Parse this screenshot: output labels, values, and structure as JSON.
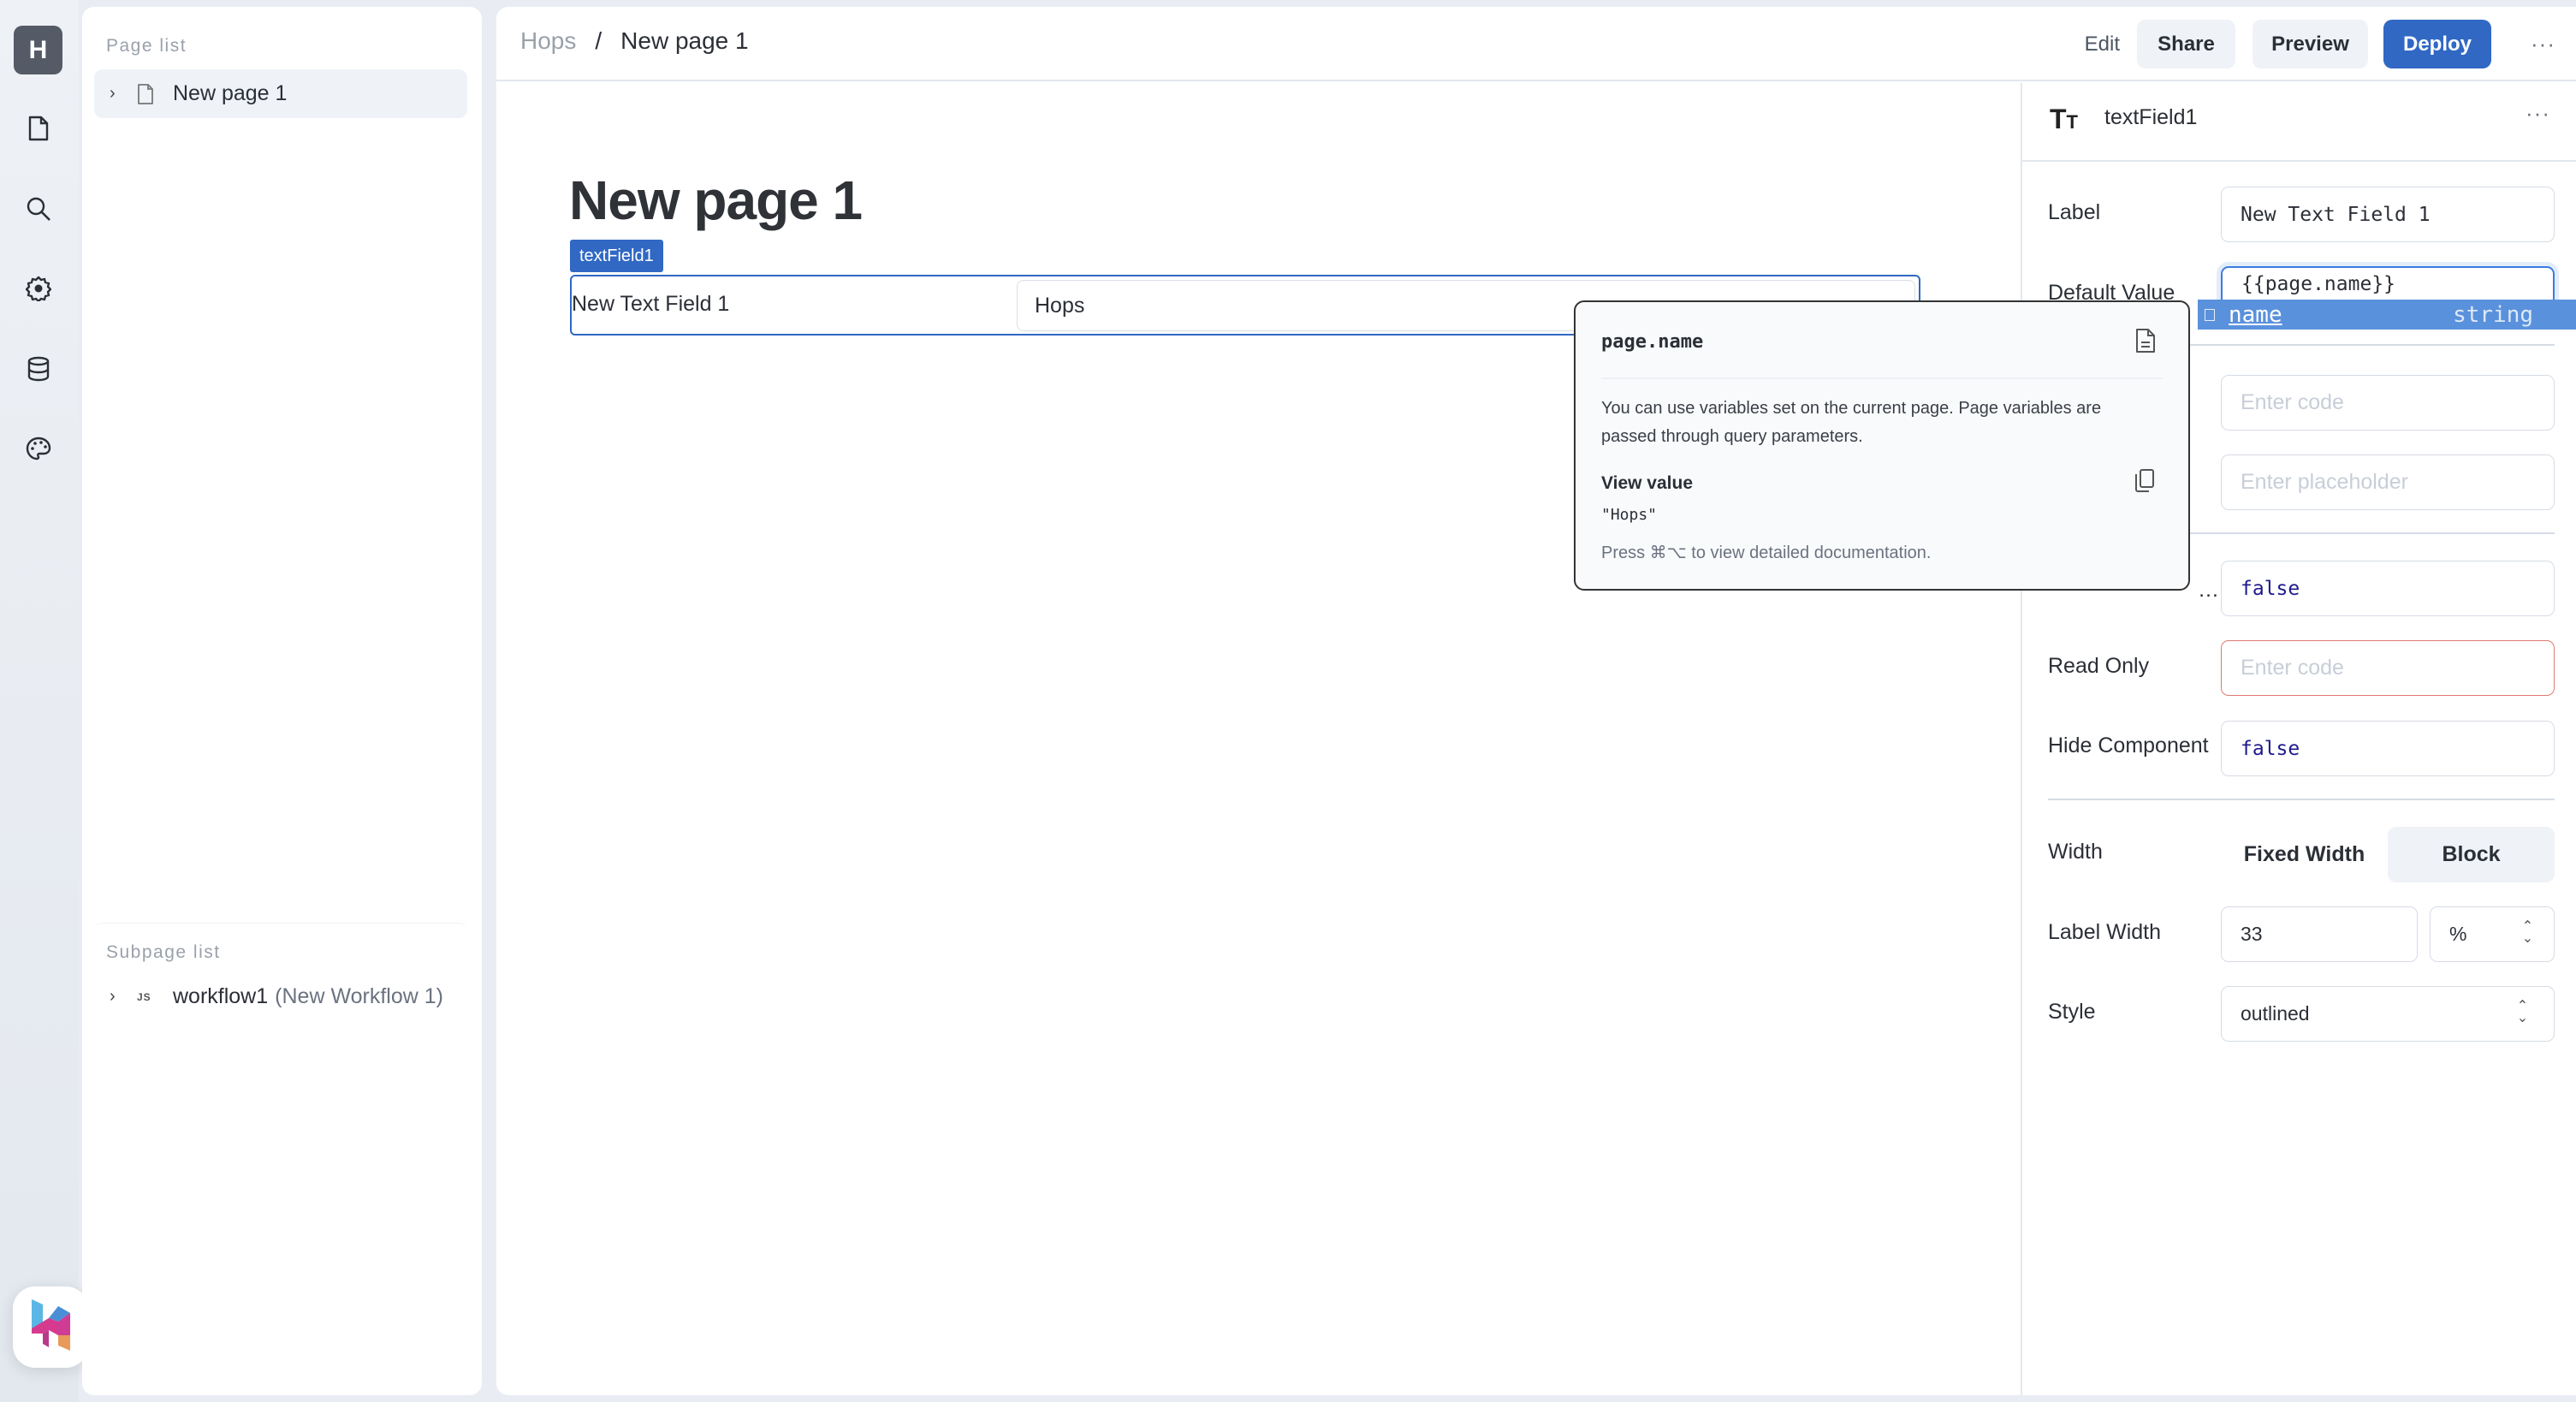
{
  "rail": {
    "workspace_initial": "H",
    "icons": [
      "page-icon",
      "search-icon",
      "gear-icon",
      "database-icon",
      "palette-icon"
    ]
  },
  "left_panel": {
    "page_list_title": "Page list",
    "pages": [
      {
        "label": "New page 1"
      }
    ],
    "subpage_list_title": "Subpage list",
    "subpages": [
      {
        "badge": "JS",
        "name": "workflow1",
        "alias": "(New Workflow 1)"
      }
    ]
  },
  "header": {
    "breadcrumb_root": "Hops",
    "breadcrumb_sep": "/",
    "breadcrumb_current": "New page 1",
    "edit_label": "Edit",
    "share_label": "Share",
    "preview_label": "Preview",
    "deploy_label": "Deploy",
    "more_label": "···"
  },
  "canvas": {
    "page_title": "New page 1",
    "component_tag": "textField1",
    "textfield_label": "New Text Field 1",
    "textfield_value": "Hops"
  },
  "props": {
    "component_icon": "Tт",
    "component_name": "textField1",
    "more_label": "···",
    "label_label": "Label",
    "label_value": "New Text Field 1",
    "default_value_label": "Default Value",
    "default_value": "{{page.name}}",
    "code_placeholder": "Enter code",
    "placeholder_placeholder": "Enter placeholder",
    "truncated_label": "…",
    "truncated_value": "false",
    "read_only_label": "Read Only",
    "read_only_placeholder": "Enter code",
    "hide_component_label": "Hide Component",
    "hide_component_value": "false",
    "width_label": "Width",
    "width_options": [
      "Fixed Width",
      "Block"
    ],
    "width_selected": "Block",
    "label_width_label": "Label Width",
    "label_width_value": "33",
    "label_width_unit": "%",
    "style_label": "Style",
    "style_value": "outlined"
  },
  "autocomplete": {
    "item_name": "name",
    "item_type": "string"
  },
  "tooltip": {
    "title": "page.name",
    "description": "You can use variables set on the current page. Page variables are passed through query parameters.",
    "view_value_label": "View value",
    "value": "\"Hops\"",
    "hint": "Press ⌘⌥ to view detailed documentation."
  },
  "colors": {
    "accent": "#3068c4",
    "autocomplete_bg": "#5a91dc",
    "error_border": "#e07a72",
    "bool_literal": "#1f1a8c"
  }
}
